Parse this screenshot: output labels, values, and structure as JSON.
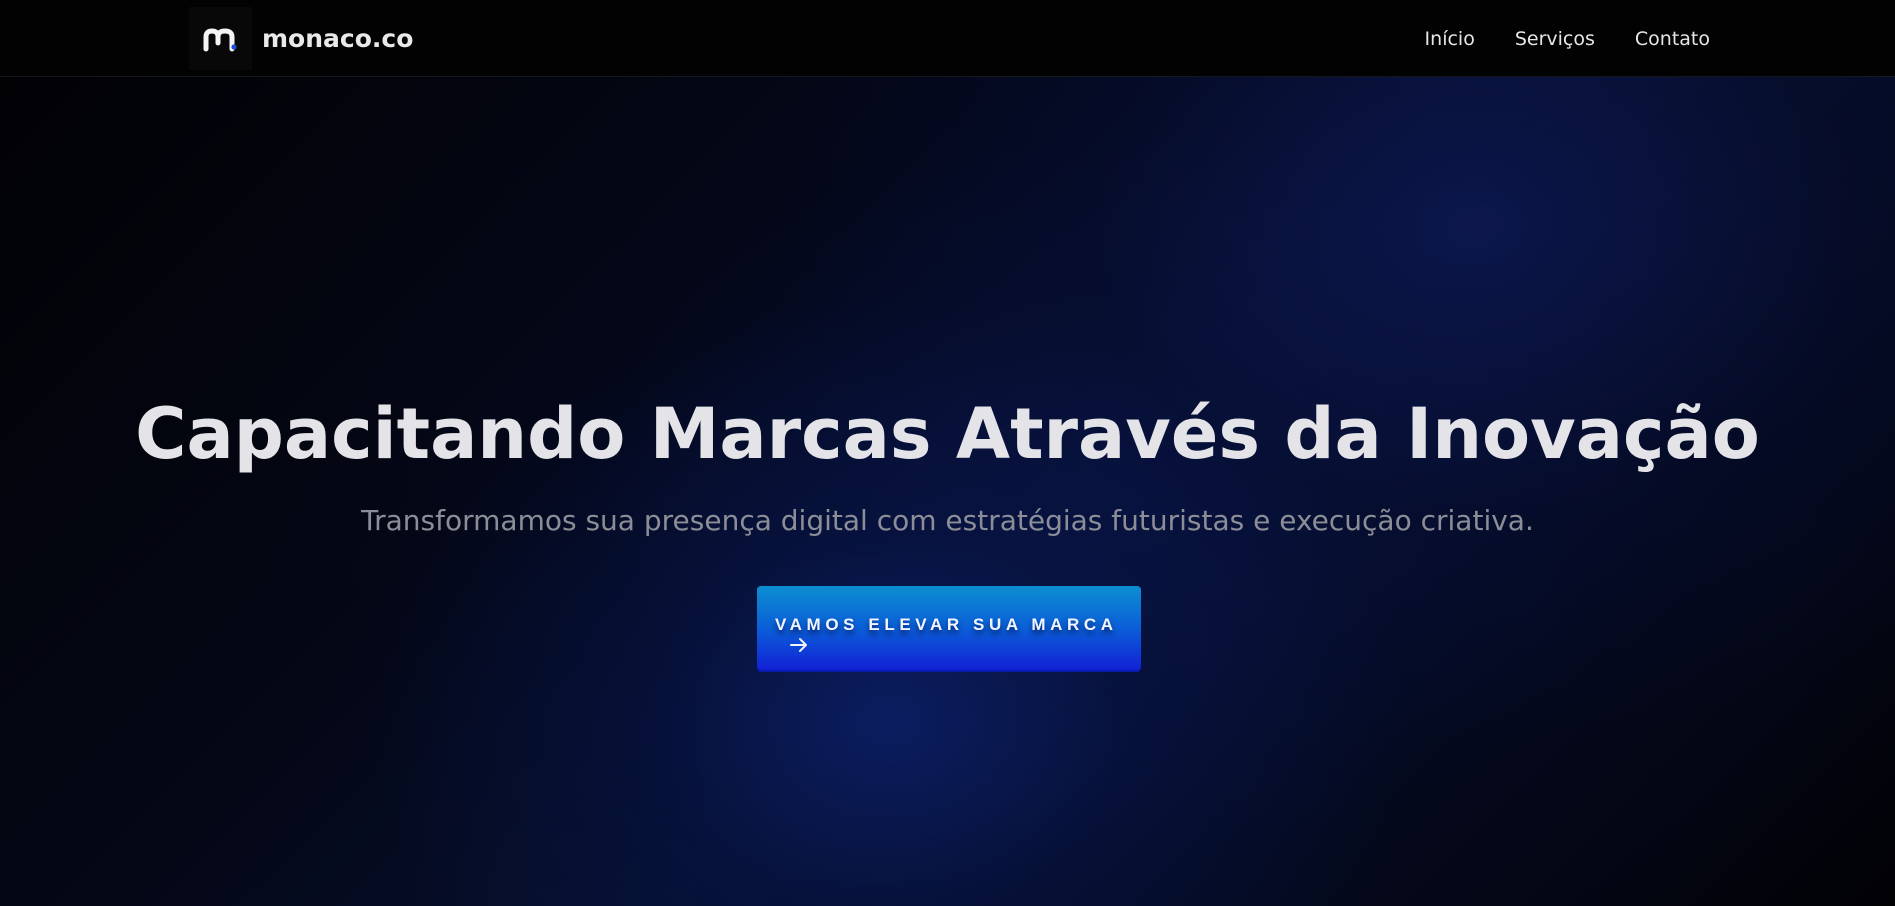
{
  "navbar": {
    "brand_name": "monaco.co",
    "links": [
      {
        "label": "Início"
      },
      {
        "label": "Serviços"
      },
      {
        "label": "Contato"
      }
    ]
  },
  "hero": {
    "title": "Capacitando Marcas Através da Inovação",
    "subtitle": "Transformamos sua presença digital com estratégias futuristas e execução criativa.",
    "cta_label": "VAMOS ELEVAR SUA MARCA",
    "cta_icon": "arrow-right-icon"
  },
  "colors": {
    "navbar_background": "#020202",
    "title_text": "#e4e4e8",
    "subtitle_text": "#8b8d97",
    "cta_gradient_top": "#0c8ed0",
    "cta_gradient_bottom": "#1221d6",
    "hero_glow": "#0c2069"
  }
}
